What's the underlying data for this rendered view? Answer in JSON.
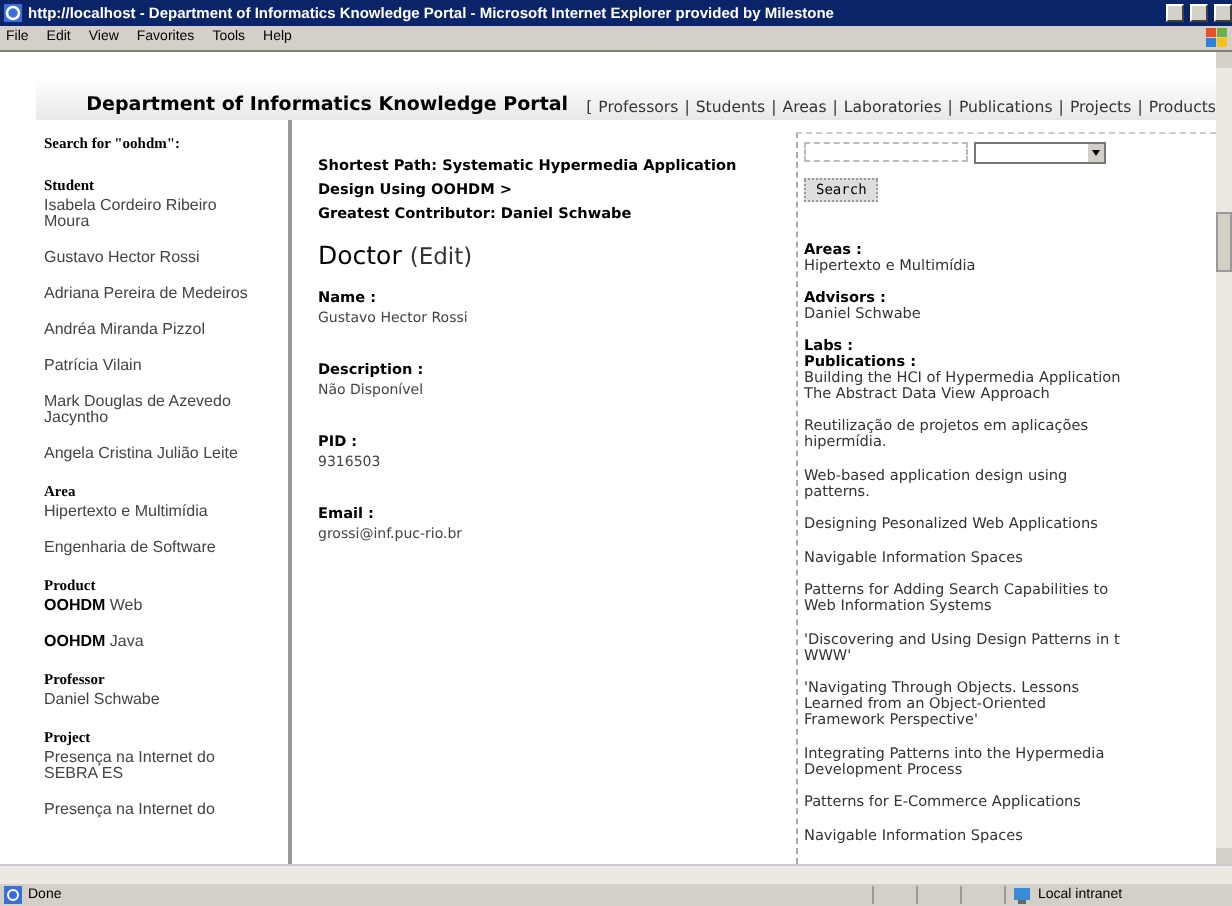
{
  "window": {
    "title": "http://localhost - Department of Informatics Knowledge Portal - Microsoft Internet Explorer provided by Milestone"
  },
  "menu": [
    "File",
    "Edit",
    "View",
    "Favorites",
    "Tools",
    "Help"
  ],
  "header": {
    "title": "Department of Informatics Knowledge Portal",
    "open": "[",
    "links": [
      "Professors",
      "Students",
      "Areas",
      "Laboratories",
      "Publications",
      "Projects",
      "Products"
    ],
    "separators": [
      "|",
      "|",
      "|",
      "|",
      "|",
      "|"
    ]
  },
  "sidebar": {
    "heading": "Search for \"oohdm\":",
    "sections": [
      {
        "title": "Student",
        "items": [
          "Isabela Cordeiro Ribeiro\nMoura",
          "Gustavo Hector Rossi",
          "Adriana Pereira de Medeiros",
          "Andréa Miranda Pizzol",
          "Patrícia Vilain",
          "Mark Douglas de Azevedo\nJacyntho",
          "Angela Cristina Julião Leite"
        ]
      },
      {
        "title": "Area",
        "items": [
          "Hipertexto e Multimídia",
          "Engenharia de Software"
        ]
      },
      {
        "title": "Product",
        "items": [
          "**OOHDM** Web",
          "**OOHDM** Java"
        ]
      },
      {
        "title": "Professor",
        "items": [
          "Daniel Schwabe"
        ]
      },
      {
        "title": "Project",
        "items": [
          "Presença na Internet do\nSEBRA ES",
          "Presença na Internet do"
        ]
      }
    ]
  },
  "main": {
    "path": [
      "Shortest Path: Systematic Hypermedia Application\nDesign Using OOHDM >",
      "Greatest Contributor: Daniel Schwabe"
    ],
    "title": "Doctor",
    "edit": "(Edit)",
    "fields": [
      {
        "label": "Name :",
        "value": "Gustavo Hector Rossi"
      },
      {
        "label": "Description :",
        "value": "Não Disponível"
      },
      {
        "label": "PID :",
        "value": "9316503"
      },
      {
        "label": "Email :",
        "value": "grossi@inf.puc-rio.br"
      }
    ]
  },
  "panel": {
    "search_button": "Search",
    "facts": [
      {
        "label": "Areas :",
        "value": "Hipertexto e Multimídia"
      },
      {
        "label": "Advisors :",
        "value": "Daniel Schwabe"
      },
      {
        "label": "Labs :"
      }
    ],
    "publications_label": "Publications :",
    "publications": [
      "Building the HCI of Hypermedia Application\nThe Abstract Data View Approach",
      "Reutilização de projetos em aplicações\nhipermídia.",
      "Web-based application design using\npatterns.",
      "Designing Pesonalized Web Applications",
      "Navigable Information Spaces",
      "Patterns for Adding Search Capabilities to\nWeb Information Systems",
      "'Discovering and Using Design Patterns in t\nWWW'",
      "'Navigating Through Objects. Lessons\nLearned from an Object-Oriented\nFramework Perspective'",
      "Integrating Patterns into the Hypermedia\nDevelopment Process",
      "Patterns for E-Commerce Applications",
      "Navigable Information Spaces"
    ]
  },
  "status_bar": {
    "text": "Done",
    "zone": "Local intranet"
  }
}
